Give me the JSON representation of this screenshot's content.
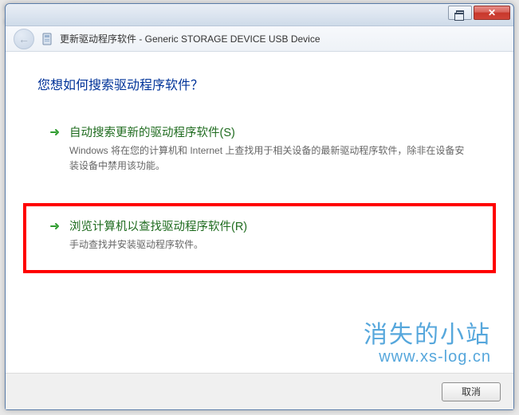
{
  "header": {
    "title": "更新驱动程序软件 - Generic STORAGE DEVICE USB Device"
  },
  "heading": "您想如何搜索驱动程序软件？",
  "options": [
    {
      "title": "自动搜索更新的驱动程序软件(S)",
      "desc": "Windows 将在您的计算机和 Internet 上查找用于相关设备的最新驱动程序软件，除非在设备安装设备中禁用该功能。"
    },
    {
      "title": "浏览计算机以查找驱动程序软件(R)",
      "desc": "手动查找并安装驱动程序软件。"
    }
  ],
  "footer": {
    "cancel": "取消"
  },
  "watermark": {
    "line1": "消失的小站",
    "line2": "www.xs-log.cn"
  }
}
